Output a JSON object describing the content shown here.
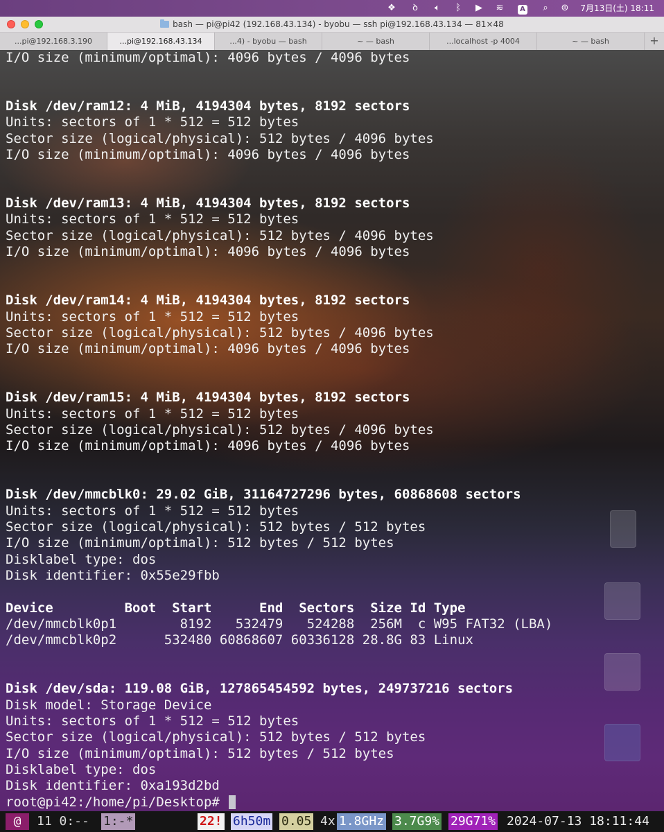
{
  "menubar": {
    "icons": [
      "dropbox-icon",
      "accessibility-icon",
      "volume-icon",
      "bluetooth-icon",
      "play-icon",
      "wifi-icon",
      "input-source-icon",
      "search-icon",
      "control-center-icon"
    ],
    "input_source": "A",
    "clock": "7月13日(土)  18:11"
  },
  "window": {
    "title": "bash — pi@pi42 (192.168.43.134) - byobu — ssh pi@192.168.43.134 — 81×48"
  },
  "tabs": [
    {
      "label": "...pi@192.168.3.190",
      "active": false
    },
    {
      "label": "...pi@192.168.43.134",
      "active": true
    },
    {
      "label": "...4) - byobu — bash",
      "active": false
    },
    {
      "label": "~ — bash",
      "active": false
    },
    {
      "label": "...localhost -p 4004",
      "active": false
    },
    {
      "label": "~ — bash",
      "active": false
    }
  ],
  "tab_add_label": "+",
  "terminal": {
    "lines": [
      {
        "text": "I/O size (minimum/optimal): 4096 bytes / 4096 bytes",
        "bold": false
      },
      {
        "text": "",
        "bold": false
      },
      {
        "text": "",
        "bold": false
      },
      {
        "text": "Disk /dev/ram12: 4 MiB, 4194304 bytes, 8192 sectors",
        "bold": true
      },
      {
        "text": "Units: sectors of 1 * 512 = 512 bytes",
        "bold": false
      },
      {
        "text": "Sector size (logical/physical): 512 bytes / 4096 bytes",
        "bold": false
      },
      {
        "text": "I/O size (minimum/optimal): 4096 bytes / 4096 bytes",
        "bold": false
      },
      {
        "text": "",
        "bold": false
      },
      {
        "text": "",
        "bold": false
      },
      {
        "text": "Disk /dev/ram13: 4 MiB, 4194304 bytes, 8192 sectors",
        "bold": true
      },
      {
        "text": "Units: sectors of 1 * 512 = 512 bytes",
        "bold": false
      },
      {
        "text": "Sector size (logical/physical): 512 bytes / 4096 bytes",
        "bold": false
      },
      {
        "text": "I/O size (minimum/optimal): 4096 bytes / 4096 bytes",
        "bold": false
      },
      {
        "text": "",
        "bold": false
      },
      {
        "text": "",
        "bold": false
      },
      {
        "text": "Disk /dev/ram14: 4 MiB, 4194304 bytes, 8192 sectors",
        "bold": true
      },
      {
        "text": "Units: sectors of 1 * 512 = 512 bytes",
        "bold": false
      },
      {
        "text": "Sector size (logical/physical): 512 bytes / 4096 bytes",
        "bold": false
      },
      {
        "text": "I/O size (minimum/optimal): 4096 bytes / 4096 bytes",
        "bold": false
      },
      {
        "text": "",
        "bold": false
      },
      {
        "text": "",
        "bold": false
      },
      {
        "text": "Disk /dev/ram15: 4 MiB, 4194304 bytes, 8192 sectors",
        "bold": true
      },
      {
        "text": "Units: sectors of 1 * 512 = 512 bytes",
        "bold": false
      },
      {
        "text": "Sector size (logical/physical): 512 bytes / 4096 bytes",
        "bold": false
      },
      {
        "text": "I/O size (minimum/optimal): 4096 bytes / 4096 bytes",
        "bold": false
      },
      {
        "text": "",
        "bold": false
      },
      {
        "text": "",
        "bold": false
      },
      {
        "text": "Disk /dev/mmcblk0: 29.02 GiB, 31164727296 bytes, 60868608 sectors",
        "bold": true
      },
      {
        "text": "Units: sectors of 1 * 512 = 512 bytes",
        "bold": false
      },
      {
        "text": "Sector size (logical/physical): 512 bytes / 512 bytes",
        "bold": false
      },
      {
        "text": "I/O size (minimum/optimal): 512 bytes / 512 bytes",
        "bold": false
      },
      {
        "text": "Disklabel type: dos",
        "bold": false
      },
      {
        "text": "Disk identifier: 0x55e29fbb",
        "bold": false
      },
      {
        "text": "",
        "bold": false
      },
      {
        "text": "Device         Boot  Start      End  Sectors  Size Id Type",
        "bold": true
      },
      {
        "text": "/dev/mmcblk0p1        8192   532479   524288  256M  c W95 FAT32 (LBA)",
        "bold": false
      },
      {
        "text": "/dev/mmcblk0p2      532480 60868607 60336128 28.8G 83 Linux",
        "bold": false
      },
      {
        "text": "",
        "bold": false
      },
      {
        "text": "",
        "bold": false
      },
      {
        "text": "Disk /dev/sda: 119.08 GiB, 127865454592 bytes, 249737216 sectors",
        "bold": true
      },
      {
        "text": "Disk model: Storage Device",
        "bold": false
      },
      {
        "text": "Units: sectors of 1 * 512 = 512 bytes",
        "bold": false
      },
      {
        "text": "Sector size (logical/physical): 512 bytes / 512 bytes",
        "bold": false
      },
      {
        "text": "I/O size (minimum/optimal): 512 bytes / 512 bytes",
        "bold": false
      },
      {
        "text": "Disklabel type: dos",
        "bold": false
      },
      {
        "text": "Disk identifier: 0xa193d2bd",
        "bold": false
      }
    ],
    "prompt": "root@pi42:/home/pi/Desktop# "
  },
  "statusbar": {
    "logo": "@",
    "window_list": "11 0:--",
    "active_window": "1:-*",
    "updates": "22!",
    "uptime": "6h50m",
    "load": "0.05",
    "cpu_count": "4x",
    "cpu_freq": "1.8GHz",
    "memory": "3.7G9%",
    "disk": "29G71%",
    "datetime": "2024-07-13 18:11:44"
  },
  "colors": {
    "accent_logo": "#8b1e6a",
    "updates_red": "#d01818",
    "freq_blue": "#7a96c8",
    "mem_green": "#4c8a4c",
    "disk_purple": "#a022b8"
  }
}
